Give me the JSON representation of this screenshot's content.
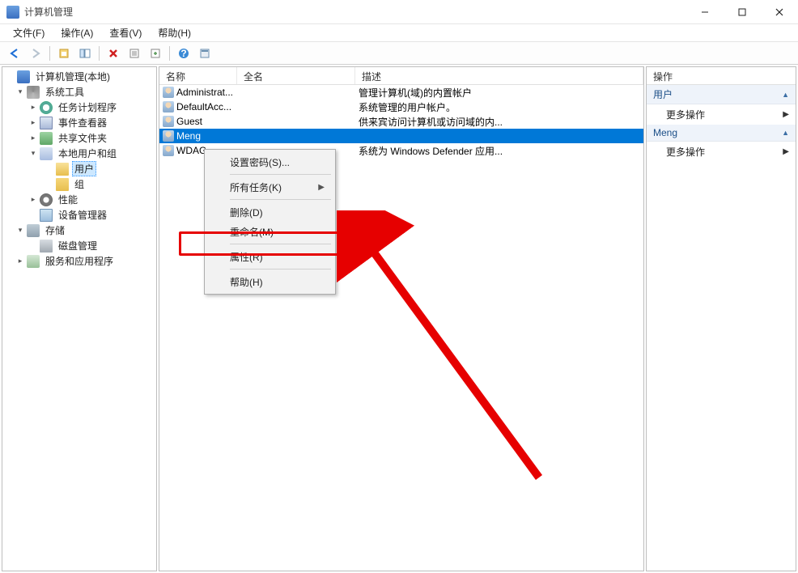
{
  "window": {
    "title": "计算机管理"
  },
  "menu": {
    "file": "文件(F)",
    "action": "操作(A)",
    "view": "查看(V)",
    "help": "帮助(H)"
  },
  "toolbar_icons": [
    "back",
    "forward",
    "up",
    "show-hide",
    "delete",
    "refresh",
    "export",
    "help",
    "props"
  ],
  "tree": {
    "root": "计算机管理(本地)",
    "system_tools": "系统工具",
    "task_scheduler": "任务计划程序",
    "event_viewer": "事件查看器",
    "shared_folders": "共享文件夹",
    "local_users": "本地用户和组",
    "users": "用户",
    "groups": "组",
    "performance": "性能",
    "device_manager": "设备管理器",
    "storage": "存储",
    "disk_mgmt": "磁盘管理",
    "services_apps": "服务和应用程序"
  },
  "list": {
    "headers": {
      "name": "名称",
      "fullname": "全名",
      "description": "描述"
    },
    "rows": [
      {
        "name": "Administrat...",
        "fullname": "",
        "description": "管理计算机(域)的内置帐户"
      },
      {
        "name": "DefaultAcc...",
        "fullname": "",
        "description": "系统管理的用户帐户。"
      },
      {
        "name": "Guest",
        "fullname": "",
        "description": "供来宾访问计算机或访问域的内..."
      },
      {
        "name": "Meng",
        "fullname": "",
        "description": ""
      },
      {
        "name": "WDAG...",
        "fullname": "",
        "description": "系统为 Windows Defender 应用..."
      }
    ],
    "selected_index": 3
  },
  "context_menu": {
    "set_password": "设置密码(S)...",
    "all_tasks": "所有任务(K)",
    "delete": "删除(D)",
    "rename": "重命名(M)",
    "properties": "属性(R)",
    "help": "帮助(H)"
  },
  "actions": {
    "title": "操作",
    "section1": "用户",
    "more1": "更多操作",
    "section2": "Meng",
    "more2": "更多操作"
  }
}
